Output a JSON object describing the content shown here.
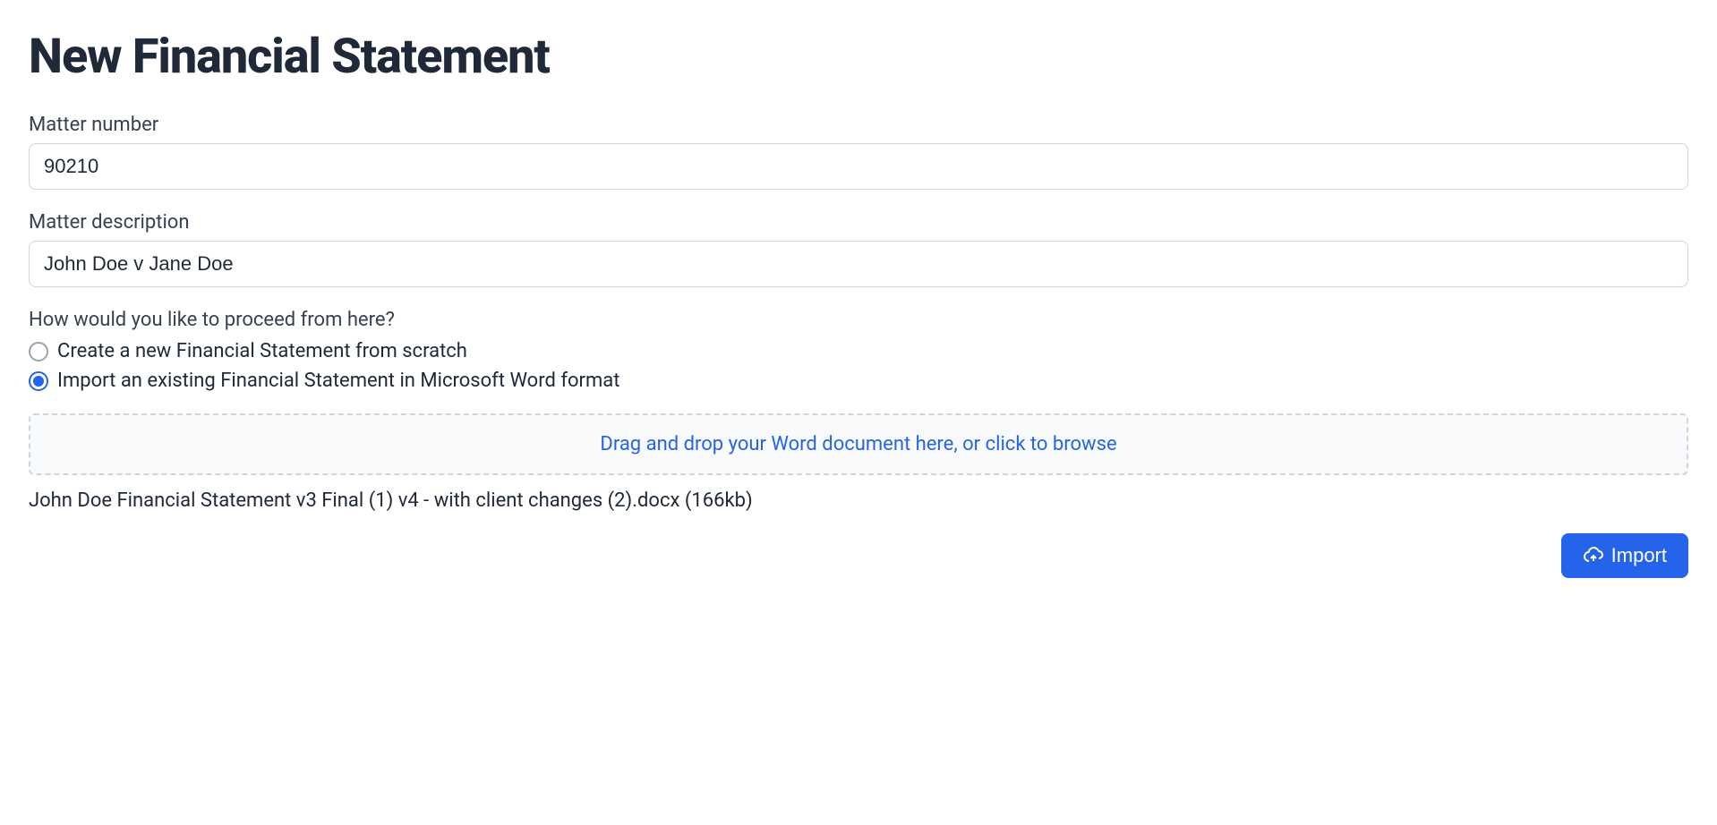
{
  "page": {
    "title": "New Financial Statement"
  },
  "form": {
    "matter_number": {
      "label": "Matter number",
      "value": "90210"
    },
    "matter_description": {
      "label": "Matter description",
      "value": "John Doe v Jane Doe"
    },
    "proceed": {
      "label": "How would you like to proceed from here?",
      "options": {
        "create": "Create a new Financial Statement from scratch",
        "import": "Import an existing Financial Statement in Microsoft Word format"
      }
    },
    "dropzone": {
      "text": "Drag and drop your Word document here, or click to browse"
    },
    "file": {
      "name": "John Doe Financial Statement v3 Final (1) v4 - with client changes (2).docx (166kb)"
    }
  },
  "buttons": {
    "import": "Import"
  }
}
